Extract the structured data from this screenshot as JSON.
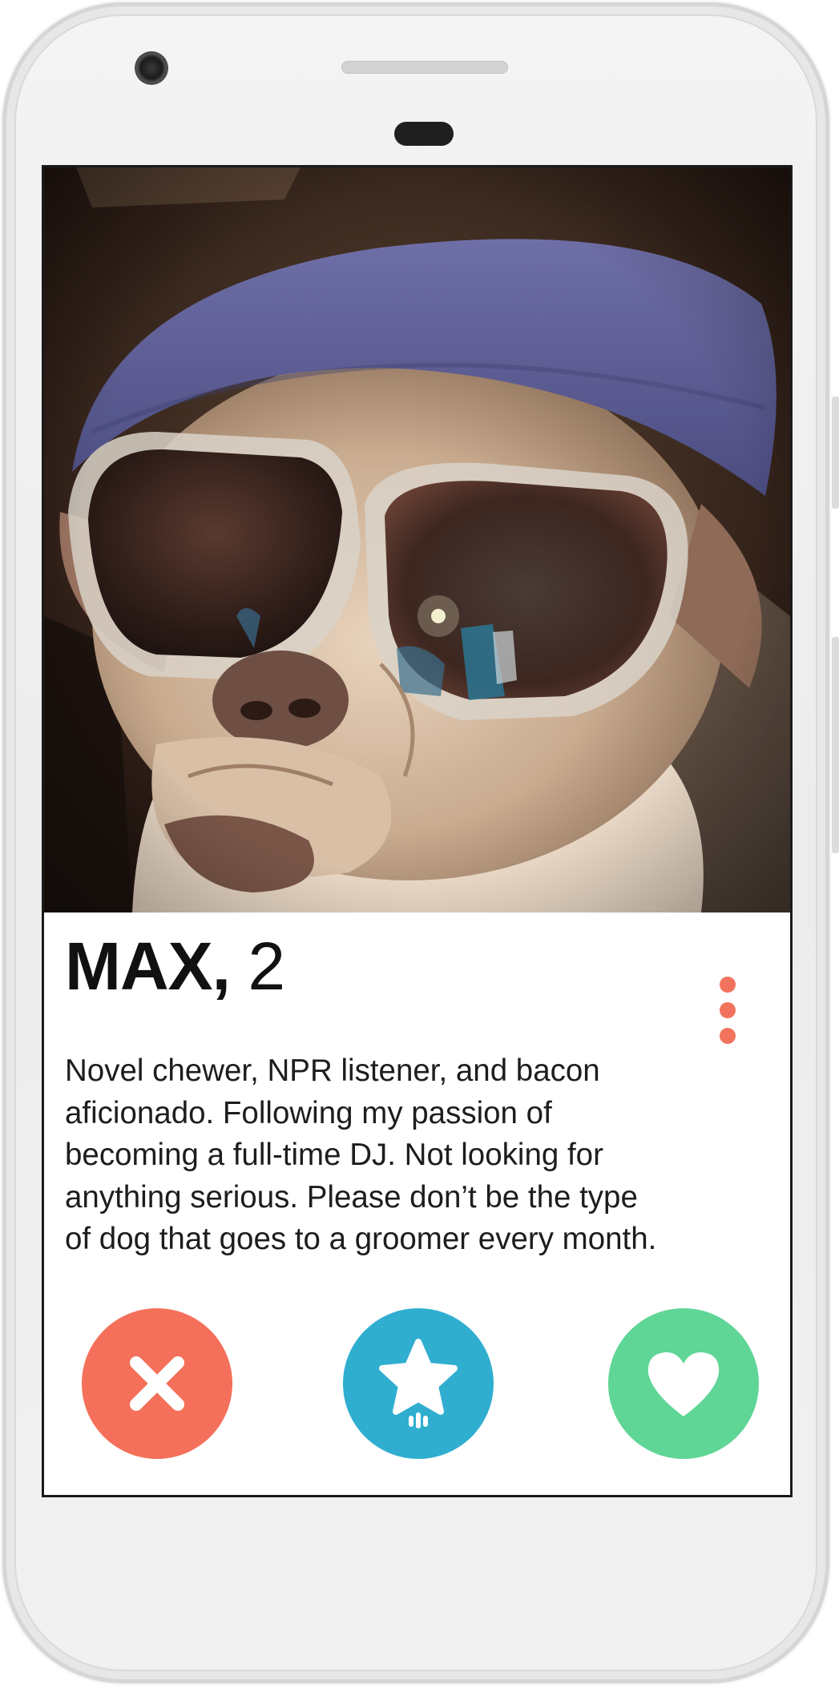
{
  "profile": {
    "name": "MAX,",
    "age": "2",
    "bio": "Novel chewer, NPR listener, and bacon\naficionado.  Following my passion of\nbecoming a full-time DJ. Not looking for\nanything serious. Please don’t be the type\nof dog that goes to a groomer every month."
  },
  "actions": {
    "nope": {
      "icon": "close-icon",
      "color": "#f4705a"
    },
    "super_like": {
      "icon": "star-icon",
      "color": "#2faed0"
    },
    "like": {
      "icon": "heart-icon",
      "color": "#5fd596"
    }
  },
  "menu": {
    "icon": "more-vertical-icon",
    "color": "#f2735d"
  }
}
